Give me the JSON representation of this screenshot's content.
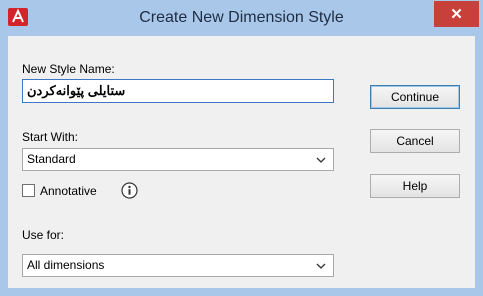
{
  "window": {
    "title": "Create New Dimension Style",
    "close_label": "✕",
    "app_icon": "autocad-logo-icon"
  },
  "form": {
    "new_style_name_label": "New Style Name:",
    "new_style_name_value": "ستایلی پێوانەکردن",
    "start_with_label": "Start With:",
    "start_with_value": "Standard",
    "annotative_label": "Annotative",
    "annotative_checked": false,
    "use_for_label": "Use for:",
    "use_for_value": "All dimensions"
  },
  "buttons": {
    "continue": "Continue",
    "cancel": "Cancel",
    "help": "Help"
  },
  "colors": {
    "titlebar": "#a9c7e8",
    "close": "#c7403a",
    "focus_border": "#3b79c4"
  }
}
